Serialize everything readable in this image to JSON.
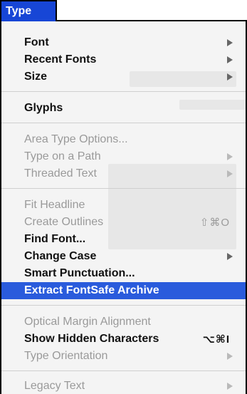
{
  "menu": {
    "title": "Type",
    "items": [
      {
        "label": "Font",
        "enabled": true,
        "submenu": true,
        "shortcut": ""
      },
      {
        "label": "Recent Fonts",
        "enabled": true,
        "submenu": true,
        "shortcut": ""
      },
      {
        "label": "Size",
        "enabled": true,
        "submenu": true,
        "shortcut": ""
      },
      {
        "label": "Glyphs",
        "enabled": true,
        "submenu": false,
        "shortcut": ""
      },
      {
        "label": "Area Type Options...",
        "enabled": false,
        "submenu": false,
        "shortcut": ""
      },
      {
        "label": "Type on a Path",
        "enabled": false,
        "submenu": true,
        "shortcut": ""
      },
      {
        "label": "Threaded Text",
        "enabled": false,
        "submenu": true,
        "shortcut": ""
      },
      {
        "label": "Fit Headline",
        "enabled": false,
        "submenu": false,
        "shortcut": ""
      },
      {
        "label": "Create Outlines",
        "enabled": false,
        "submenu": false,
        "shortcut": "⇧⌘O"
      },
      {
        "label": "Find Font...",
        "enabled": true,
        "submenu": false,
        "shortcut": ""
      },
      {
        "label": "Change Case",
        "enabled": true,
        "submenu": true,
        "shortcut": ""
      },
      {
        "label": "Smart Punctuation...",
        "enabled": true,
        "submenu": false,
        "shortcut": ""
      },
      {
        "label": "Extract FontSafe Archive",
        "enabled": true,
        "submenu": false,
        "shortcut": "",
        "highlighted": true
      },
      {
        "label": "Optical Margin Alignment",
        "enabled": false,
        "submenu": false,
        "shortcut": ""
      },
      {
        "label": "Show Hidden Characters",
        "enabled": true,
        "submenu": false,
        "shortcut": "⌥⌘I"
      },
      {
        "label": "Type Orientation",
        "enabled": false,
        "submenu": true,
        "shortcut": ""
      },
      {
        "label": "Legacy Text",
        "enabled": false,
        "submenu": true,
        "shortcut": ""
      }
    ]
  },
  "colors": {
    "highlight": "#2a5bdc",
    "title_bg": "#1746d6",
    "disabled_text": "#9a9a9a"
  }
}
